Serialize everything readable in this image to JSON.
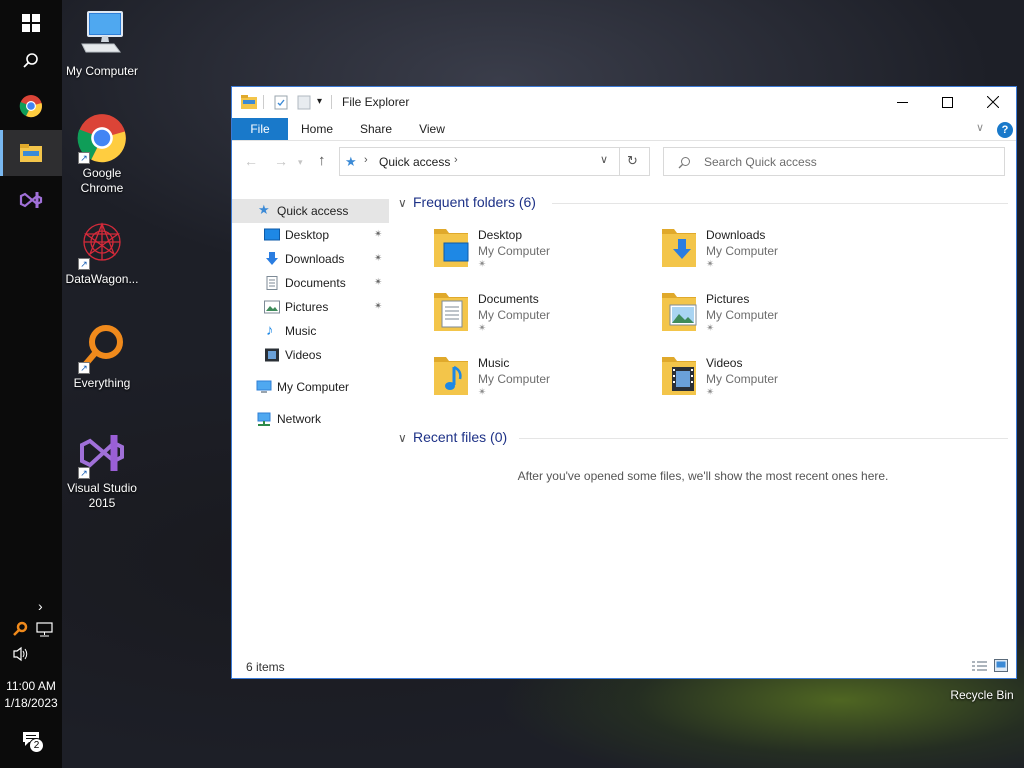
{
  "taskbar": {
    "clock_time": "11:00 AM",
    "clock_date": "1/18/2023",
    "notifications_count": "2",
    "buttons": [
      {
        "icon": "windows-start-icon"
      },
      {
        "icon": "search-icon"
      },
      {
        "icon": "chrome-icon"
      },
      {
        "icon": "file-explorer-icon",
        "active": true
      },
      {
        "icon": "visual-studio-icon"
      }
    ]
  },
  "desktop": {
    "icons": [
      {
        "label": "My Computer",
        "icon": "computer-icon"
      },
      {
        "label": "Google Chrome",
        "icon": "chrome-icon"
      },
      {
        "label": "DataWagon...",
        "icon": "datawagon-icon"
      },
      {
        "label": "Everything",
        "icon": "everything-search-icon"
      },
      {
        "label": "Visual Studio 2015",
        "icon": "visual-studio-icon"
      },
      {
        "label": "Recycle Bin",
        "icon": "recycle-bin-icon"
      }
    ]
  },
  "window": {
    "title": "File Explorer",
    "ribbon_tabs": [
      "File",
      "Home",
      "Share",
      "View"
    ],
    "address": {
      "path": "Quick access"
    },
    "search": {
      "placeholder": "Search Quick access"
    },
    "nav": {
      "quick_access": "Quick access",
      "pinned": [
        {
          "label": "Desktop",
          "icon": "desktop-folder-icon",
          "pinned": true
        },
        {
          "label": "Downloads",
          "icon": "downloads-folder-icon",
          "pinned": true
        },
        {
          "label": "Documents",
          "icon": "documents-folder-icon",
          "pinned": true
        },
        {
          "label": "Pictures",
          "icon": "pictures-folder-icon",
          "pinned": true
        },
        {
          "label": "Music",
          "icon": "music-folder-icon",
          "pinned": false
        },
        {
          "label": "Videos",
          "icon": "videos-folder-icon",
          "pinned": false
        }
      ],
      "this_pc": "My Computer",
      "network": "Network"
    },
    "frequent_folders": {
      "heading": "Frequent folders (6)",
      "items": [
        {
          "name": "Desktop",
          "location": "My Computer",
          "icon": "desktop-folder-icon"
        },
        {
          "name": "Downloads",
          "location": "My Computer",
          "icon": "downloads-folder-icon"
        },
        {
          "name": "Documents",
          "location": "My Computer",
          "icon": "documents-folder-icon"
        },
        {
          "name": "Pictures",
          "location": "My Computer",
          "icon": "pictures-folder-icon"
        },
        {
          "name": "Music",
          "location": "My Computer",
          "icon": "music-folder-icon"
        },
        {
          "name": "Videos",
          "location": "My Computer",
          "icon": "videos-folder-icon"
        }
      ]
    },
    "recent_files": {
      "heading": "Recent files (0)",
      "empty_message": "After you've opened some files, we'll show the most recent ones here."
    },
    "status": {
      "item_count": "6 items"
    }
  },
  "colors": {
    "accent": "#1979ca",
    "section_heading": "#1e3287",
    "folder_yellow": "#f3c54a"
  }
}
